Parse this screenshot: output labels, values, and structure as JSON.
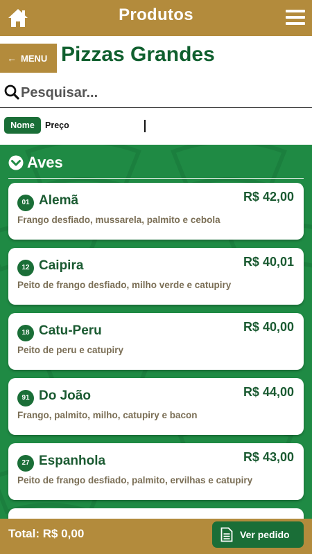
{
  "header": {
    "title": "Produtos",
    "home_icon": "home-icon",
    "menu_icon": "hamburger-icon",
    "bg": "#b38b3c"
  },
  "nav": {
    "menu_label": "MENU",
    "page_title": "Pizzas Grandes"
  },
  "search": {
    "placeholder": "Pesquisar..."
  },
  "sort": {
    "name_label": "Nome",
    "price_label": "Preço"
  },
  "category": {
    "label": "Aves",
    "icon": "chevron-down-circle-icon"
  },
  "items": [
    {
      "code": "01",
      "name": "Alemã",
      "price": "R$ 42,00",
      "desc": "Frango desfiado, mussarela, palmito e cebola"
    },
    {
      "code": "12",
      "name": "Caipira",
      "price": "R$ 40,01",
      "desc": "Peito de frango desfiado, milho verde e catupiry"
    },
    {
      "code": "18",
      "name": "Catu-Peru",
      "price": "R$ 40,00",
      "desc": "Peito de peru e catupiry"
    },
    {
      "code": "91",
      "name": "Do João",
      "price": "R$ 44,00",
      "desc": "Frango, palmito, milho, catupiry e bacon"
    },
    {
      "code": "27",
      "name": "Espanhola",
      "price": "R$ 43,00",
      "desc": "Peito de frango desfiado, palmito, ervilhas e catupiry"
    }
  ],
  "footer": {
    "total": "Total: R$ 0,00",
    "order_label": "Ver pedido"
  },
  "colors": {
    "gold": "#b38b3c",
    "green": "#1f8a44",
    "dark_green": "#1a6e37",
    "title_green": "#0f5f2e"
  }
}
